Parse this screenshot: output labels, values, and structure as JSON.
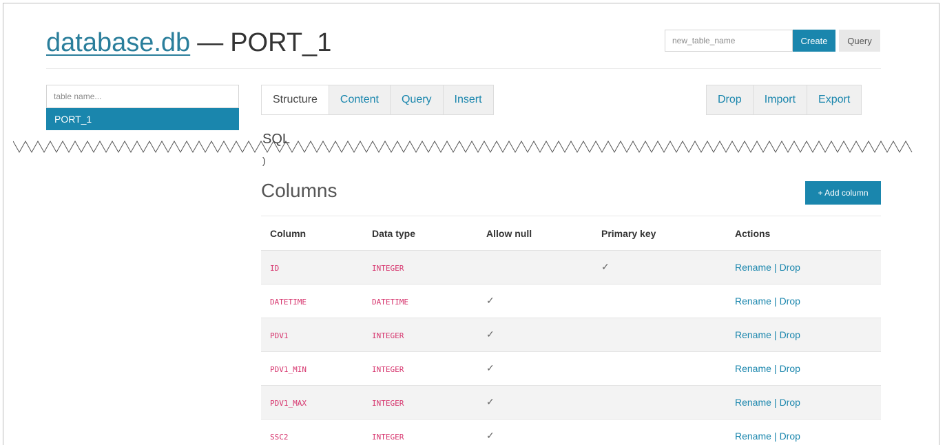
{
  "header": {
    "db_name": "database.db",
    "dash": "—",
    "table_name": "PORT_1",
    "new_table_placeholder": "new_table_name",
    "create_label": "Create",
    "query_label": "Query"
  },
  "sidebar": {
    "search_placeholder": "table name...",
    "items": [
      {
        "label": "PORT_1"
      }
    ]
  },
  "tabs": {
    "left": [
      "Structure",
      "Content",
      "Query",
      "Insert"
    ],
    "right": [
      "Drop",
      "Import",
      "Export"
    ],
    "active": "Structure"
  },
  "sql": {
    "label": "SQL",
    "paren": ")"
  },
  "columns_section": {
    "title": "Columns",
    "add_label": "+ Add column",
    "headers": [
      "Column",
      "Data type",
      "Allow null",
      "Primary key",
      "Actions"
    ],
    "rename_label": "Rename",
    "separator": "|",
    "drop_label": "Drop",
    "check": "✓",
    "rows": [
      {
        "name": "ID",
        "type": "INTEGER",
        "allow_null": false,
        "primary_key": true
      },
      {
        "name": "DATETIME",
        "type": "DATETIME",
        "allow_null": true,
        "primary_key": false
      },
      {
        "name": "PDV1",
        "type": "INTEGER",
        "allow_null": true,
        "primary_key": false
      },
      {
        "name": "PDV1_MIN",
        "type": "INTEGER",
        "allow_null": true,
        "primary_key": false
      },
      {
        "name": "PDV1_MAX",
        "type": "INTEGER",
        "allow_null": true,
        "primary_key": false
      },
      {
        "name": "SSC2",
        "type": "INTEGER",
        "allow_null": true,
        "primary_key": false
      }
    ]
  },
  "colors": {
    "accent": "#1a86ad",
    "link": "#2a7e9b",
    "code": "#d6336c",
    "row_alt": "#f3f3f3"
  }
}
